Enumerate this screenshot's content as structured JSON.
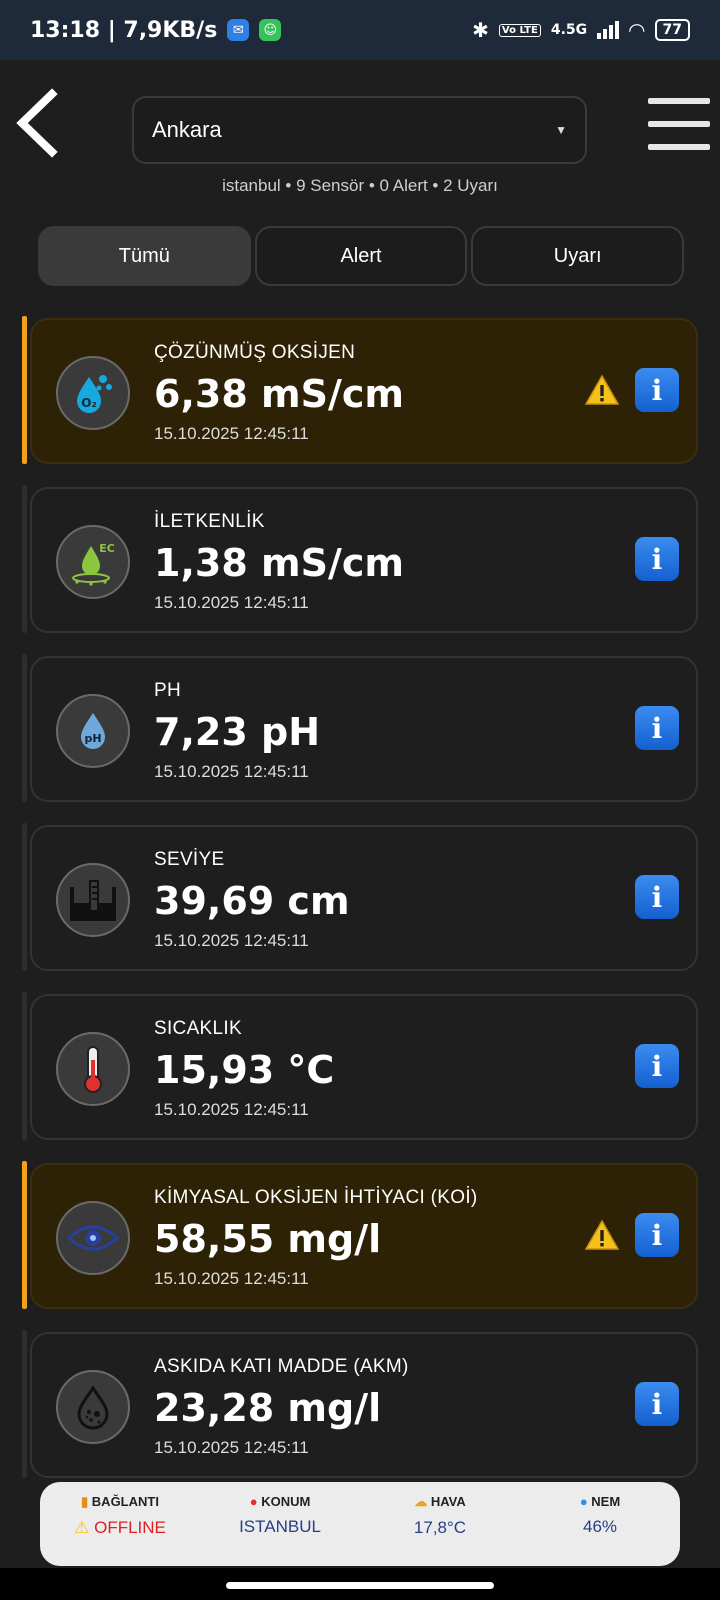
{
  "status_bar": {
    "time": "13:18 | 7,9KB/s",
    "network": "4.5G",
    "battery": "77"
  },
  "header": {
    "city": "Ankara",
    "subinfo": "istanbul • 9 Sensör • 0 Alert • 2 Uyarı"
  },
  "tabs": [
    {
      "label": "Tümü"
    },
    {
      "label": "Alert"
    },
    {
      "label": "Uyarı"
    }
  ],
  "sensors": [
    {
      "title": "ÇÖZÜNMÜŞ OKSİJEN",
      "value": "6,38 mS/cm",
      "time": "15.10.2025 12:45:11",
      "warning": true,
      "icon": "oxygen-icon"
    },
    {
      "title": "İLETKENLİK",
      "value": "1,38 mS/cm",
      "time": "15.10.2025 12:45:11",
      "warning": false,
      "icon": "conductivity-icon"
    },
    {
      "title": "PH",
      "value": "7,23 pH",
      "time": "15.10.2025 12:45:11",
      "warning": false,
      "icon": "ph-drop-icon"
    },
    {
      "title": "SEVİYE",
      "value": "39,69 cm",
      "time": "15.10.2025 12:45:11",
      "warning": false,
      "icon": "level-tank-icon"
    },
    {
      "title": "SICAKLIK",
      "value": "15,93 °C",
      "time": "15.10.2025 12:45:11",
      "warning": false,
      "icon": "thermometer-icon"
    },
    {
      "title": "KİMYASAL OKSİJEN İHTİYACI (KOİ)",
      "value": "58,55 mg/l",
      "time": "15.10.2025 12:45:11",
      "warning": true,
      "icon": "chemical-eye-icon"
    },
    {
      "title": "ASKIDA KATI MADDE (AKM)",
      "value": "23,28 mg/l",
      "time": "15.10.2025 12:45:11",
      "warning": false,
      "icon": "suspended-solids-icon"
    }
  ],
  "bottom_bar": {
    "connection_label": "BAĞLANTI",
    "connection_value": "OFFLINE",
    "location_label": "KONUM",
    "location_value": "ISTANBUL",
    "weather_label": "HAVA",
    "weather_value": "17,8°C",
    "humidity_label": "NEM",
    "humidity_value": "46%"
  },
  "colors": {
    "warning_accent": "#f2a31b",
    "info_blue": "#1f6fe0",
    "offline_red": "#e02020"
  }
}
